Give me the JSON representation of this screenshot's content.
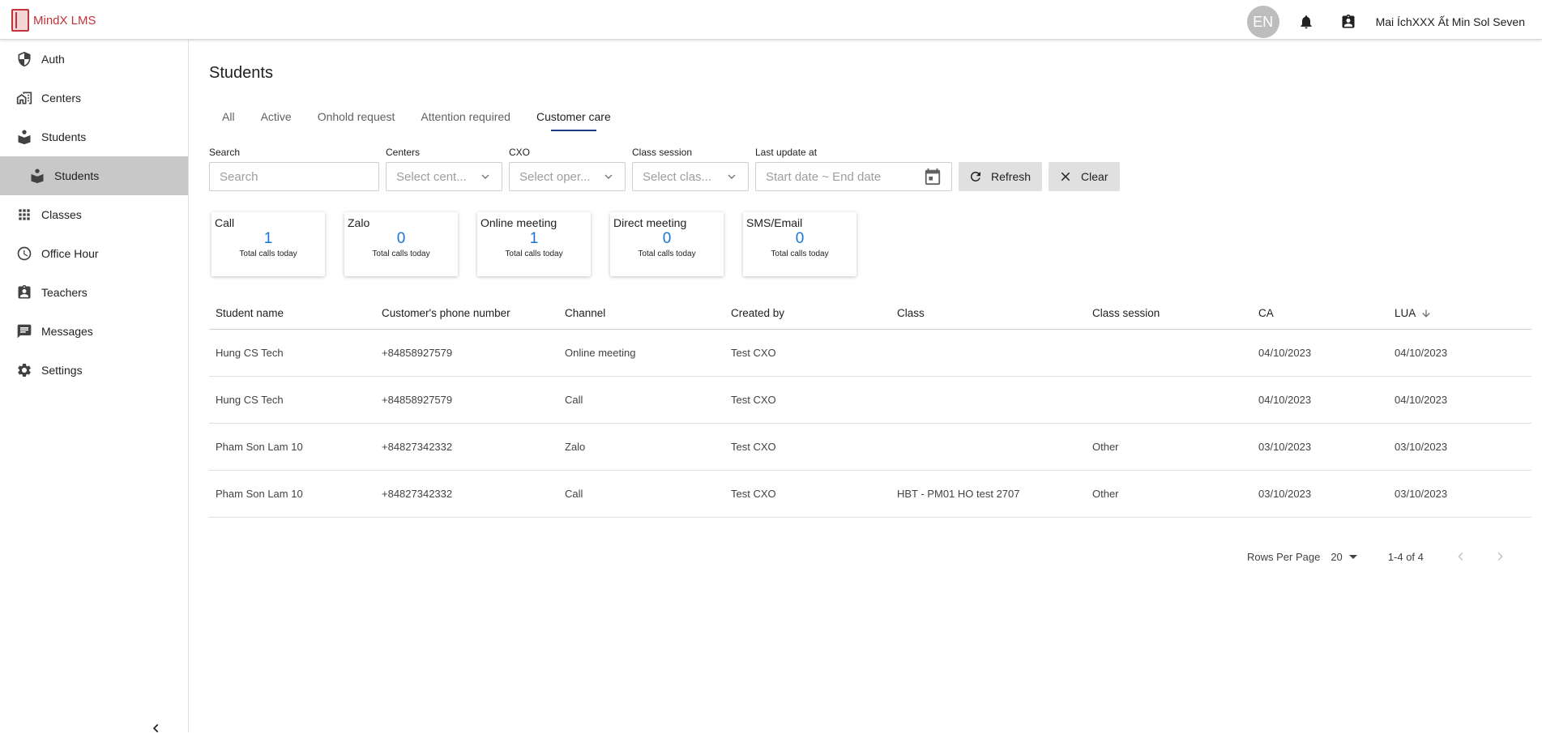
{
  "app": {
    "name": "MindX LMS"
  },
  "topbar": {
    "lang": "EN",
    "user_name": "Mai ÍchXXX Ất Min Sol Seven"
  },
  "sidebar": {
    "items": [
      {
        "label": "Auth",
        "icon": "shield-icon"
      },
      {
        "label": "Centers",
        "icon": "building-icon"
      },
      {
        "label": "Students",
        "icon": "book-reader-icon"
      },
      {
        "label": "Students",
        "icon": "book-reader-icon",
        "sub": true,
        "active": true
      },
      {
        "label": "Classes",
        "icon": "grid-icon"
      },
      {
        "label": "Office Hour",
        "icon": "clock-icon"
      },
      {
        "label": "Teachers",
        "icon": "badge-icon"
      },
      {
        "label": "Messages",
        "icon": "message-icon"
      },
      {
        "label": "Settings",
        "icon": "gear-icon"
      }
    ]
  },
  "page": {
    "title": "Students"
  },
  "tabs": [
    {
      "label": "All"
    },
    {
      "label": "Active"
    },
    {
      "label": "Onhold request"
    },
    {
      "label": "Attention required"
    },
    {
      "label": "Customer care",
      "active": true
    }
  ],
  "filters": {
    "search": {
      "label": "Search",
      "placeholder": "Search"
    },
    "centers": {
      "label": "Centers",
      "placeholder": "Select cent..."
    },
    "cxo": {
      "label": "CXO",
      "placeholder": "Select oper..."
    },
    "class_session": {
      "label": "Class session",
      "placeholder": "Select clas..."
    },
    "last_update": {
      "label": "Last update at",
      "placeholder": "Start date ~ End date"
    },
    "refresh_label": "Refresh",
    "clear_label": "Clear"
  },
  "cards": [
    {
      "title": "Call",
      "value": "1",
      "sub": "Total calls today"
    },
    {
      "title": "Zalo",
      "value": "0",
      "sub": "Total calls today"
    },
    {
      "title": "Online meeting",
      "value": "1",
      "sub": "Total calls today"
    },
    {
      "title": "Direct meeting",
      "value": "0",
      "sub": "Total calls today"
    },
    {
      "title": "SMS/Email",
      "value": "0",
      "sub": "Total calls today"
    }
  ],
  "table": {
    "headers": [
      "Student name",
      "Customer's phone number",
      "Channel",
      "Created by",
      "Class",
      "Class session",
      "CA",
      "LUA"
    ],
    "rows": [
      [
        "Hung CS Tech",
        "+84858927579",
        "Online meeting",
        "Test CXO",
        "",
        "",
        "04/10/2023",
        "04/10/2023"
      ],
      [
        "Hung CS Tech",
        "+84858927579",
        "Call",
        "Test CXO",
        "",
        "",
        "04/10/2023",
        "04/10/2023"
      ],
      [
        "Pham Son Lam 10",
        "+84827342332",
        "Zalo",
        "Test CXO",
        "",
        "Other",
        "03/10/2023",
        "03/10/2023"
      ],
      [
        "Pham Son Lam 10",
        "+84827342332",
        "Call",
        "Test CXO",
        "HBT - PM01 HO test 2707",
        "Other",
        "03/10/2023",
        "03/10/2023"
      ]
    ]
  },
  "pagination": {
    "rows_label": "Rows Per Page",
    "rows_value": "20",
    "range": "1-4 of 4"
  }
}
